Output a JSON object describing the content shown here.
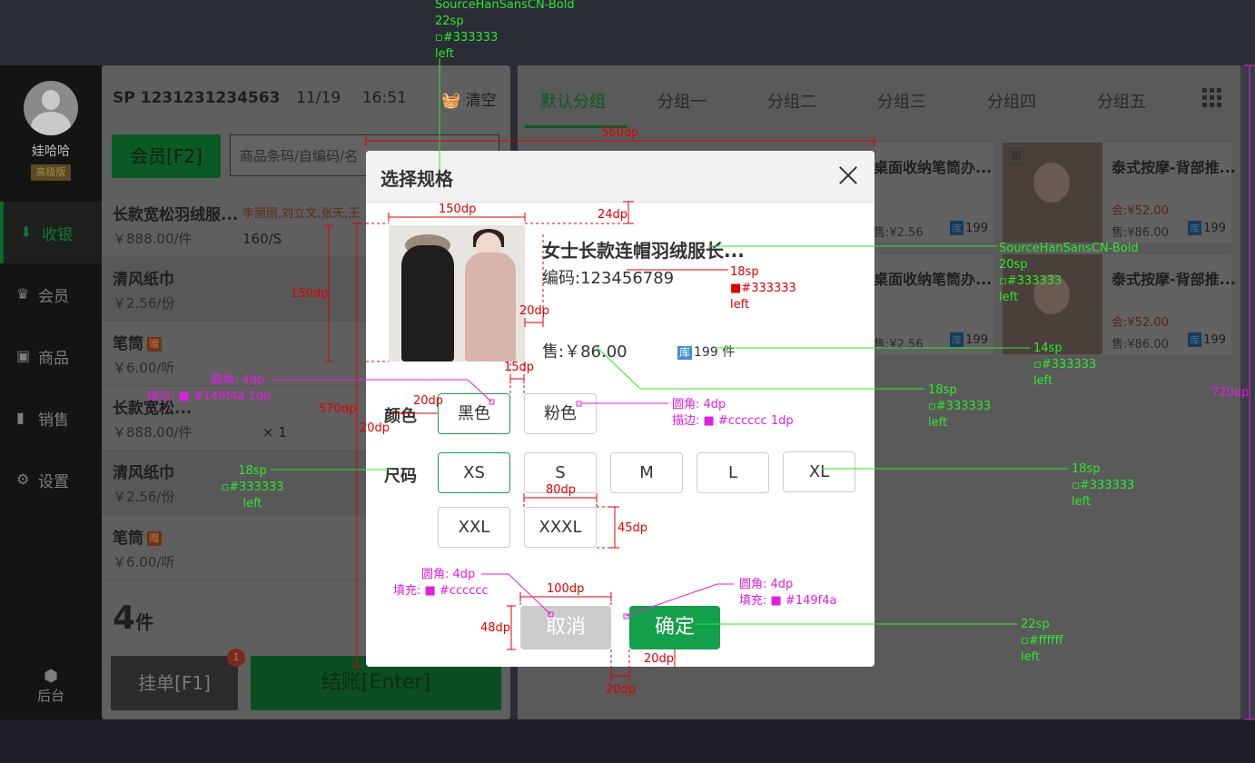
{
  "sidebar": {
    "user_name": "娃哈哈",
    "user_level": "高级版",
    "items": [
      {
        "label": "收银",
        "icon": "download-icon",
        "active": true
      },
      {
        "label": "会员",
        "icon": "crown-icon",
        "active": false
      },
      {
        "label": "商品",
        "icon": "box-icon",
        "active": false
      },
      {
        "label": "销售",
        "icon": "bar-chart-icon",
        "active": false
      },
      {
        "label": "设置",
        "icon": "gear-icon",
        "active": false
      }
    ],
    "backend_label": "后台"
  },
  "cart": {
    "order_no": "SP 1231231234563",
    "date": "11/19",
    "time": "16:51",
    "clear_label": "清空",
    "member_button": "会员[F2]",
    "search_placeholder": "商品条码/自编码/名",
    "rows": [
      {
        "name": "长款宽松羽绒服...",
        "staff": "李丽丽,刘立文,张天,王",
        "price": "￥888.00/件",
        "spec": "160/S",
        "tag": ""
      },
      {
        "name": "清风纸巾",
        "staff": "",
        "price": "￥2.56/份",
        "spec": "",
        "tag": ""
      },
      {
        "name": "笔筒",
        "staff": "",
        "price": "￥6.00/听",
        "spec": "",
        "tag": "赠"
      },
      {
        "name": "长款宽松...",
        "staff": "",
        "price": "￥888.00/件",
        "spec": "× 1",
        "tag": ""
      },
      {
        "name": "清风纸巾",
        "staff": "",
        "price": "￥2.56/份",
        "spec": "",
        "tag": ""
      },
      {
        "name": "笔筒",
        "staff": "",
        "price": "￥6.00/听",
        "spec": "",
        "tag": "赠"
      }
    ],
    "item_count": "4",
    "item_unit": "件",
    "hold_button": "挂单[F1]",
    "hold_badge": "1",
    "pay_button": "结账[Enter]"
  },
  "products": {
    "tabs": [
      "默认分组",
      "分组一",
      "分组二",
      "分组三",
      "分组四",
      "分组五"
    ],
    "cards": [
      {
        "title": "桌面收纳笔筒办...",
        "member_price": "",
        "sale_price": "售:¥2.56",
        "stock": "199",
        "stock_tag": "库"
      },
      {
        "title": "泰式按摩-背部推...",
        "member_price": "会:¥52.00",
        "sale_price": "售:¥86.00",
        "stock": "199",
        "stock_tag": "库",
        "badge": "服"
      },
      {
        "title": "桌面收纳笔筒办...",
        "member_price": "",
        "sale_price": "售:¥2.56",
        "stock": "199",
        "stock_tag": "库"
      },
      {
        "title": "泰式按摩-背部推...",
        "member_price": "会:¥52.00",
        "sale_price": "售:¥86.00",
        "stock": "199",
        "stock_tag": "库"
      }
    ]
  },
  "dialog": {
    "title": "选择规格",
    "product_name": "女士长款连帽羽绒服长...",
    "code": "编码:123456789",
    "price": "售:￥86.00",
    "stock_tag": "库",
    "stock": "199 件",
    "color_label": "颜色",
    "colors": [
      {
        "label": "黑色",
        "selected": true
      },
      {
        "label": "粉色",
        "selected": false
      }
    ],
    "size_label": "尺码",
    "sizes": [
      {
        "label": "XS",
        "selected": true
      },
      {
        "label": "S",
        "selected": false
      },
      {
        "label": "M",
        "selected": false
      },
      {
        "label": "L",
        "selected": false
      },
      {
        "label": "XL",
        "selected": false
      },
      {
        "label": "XXL",
        "selected": false
      },
      {
        "label": "XXXL",
        "selected": false
      }
    ],
    "cancel_label": "取消",
    "confirm_label": "确定"
  },
  "colors": {
    "primary": "#149f4a",
    "text": "#333333",
    "border": "#cccccc",
    "cancel_fill": "#cccccc",
    "annotation_green": "#2ee62e",
    "annotation_red": "#e00000",
    "annotation_magenta": "#e01ee0"
  },
  "annotations": {
    "title_font": [
      "SourceHanSansCN-Bold",
      "22sp",
      "#333333",
      "left"
    ],
    "name_font": [
      "SourceHanSansCN-Bold",
      "20sp",
      "#333333",
      "left"
    ],
    "code_font": [
      "18sp",
      "#333333",
      "left"
    ],
    "stock_font": [
      "14sp",
      "#333333",
      "left"
    ],
    "price_font": [
      "18sp",
      "#333333",
      "left"
    ],
    "size_font": [
      "18sp",
      "#333333",
      "left"
    ],
    "label_font": [
      "18sp",
      "#333333",
      "left"
    ],
    "button_font": [
      "22sp",
      "#ffffff",
      "left"
    ],
    "sel_radius": "圆角: 4dp",
    "sel_stroke": "描边: ■ #149f4a  1dp",
    "opt_radius": "圆角: 4dp",
    "opt_stroke": "描边: ■ #cccccc  1dp",
    "cancel_radius": "圆角: 4dp",
    "cancel_fill": "填充: ■ #cccccc",
    "ok_radius": "圆角: 4dp",
    "ok_fill": "填充: ■ #149f4a",
    "dims": {
      "dialog_width": "560dp",
      "image_width": "150dp",
      "image_height": "150dp",
      "top_gap": "24dp",
      "img_gap": "20dp",
      "label_gap": "20dp",
      "opt_gap": "15dp",
      "dialog_height": "570dp",
      "side": "20dp",
      "opt_width": "80dp",
      "opt_height": "45dp",
      "btn_width": "100dp",
      "btn_height": "48dp",
      "btn_gap": "20dp",
      "bottom_gap": "20dp",
      "screen_height": "720dp"
    }
  }
}
